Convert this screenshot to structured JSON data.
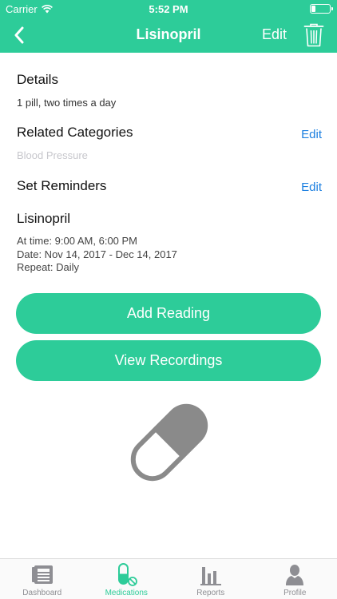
{
  "status_bar": {
    "carrier": "Carrier",
    "time": "5:52 PM"
  },
  "nav": {
    "title": "Lisinopril",
    "edit_label": "Edit"
  },
  "details": {
    "heading": "Details",
    "text": "1 pill, two times a day"
  },
  "categories": {
    "heading": "Related Categories",
    "edit_label": "Edit",
    "value": "Blood Pressure"
  },
  "reminders": {
    "heading": "Set Reminders",
    "edit_label": "Edit",
    "name": "Lisinopril",
    "time_line": "At time: 9:00 AM, 6:00 PM",
    "date_line": "Date: Nov 14, 2017 - Dec 14, 2017",
    "repeat_line": "Repeat: Daily"
  },
  "actions": {
    "add_reading": "Add Reading",
    "view_recordings": "View Recordings"
  },
  "tabs": [
    {
      "label": "Dashboard",
      "icon": "newspaper-icon",
      "active": false
    },
    {
      "label": "Medications",
      "icon": "pill-icon",
      "active": true
    },
    {
      "label": "Reports",
      "icon": "bar-chart-icon",
      "active": false
    },
    {
      "label": "Profile",
      "icon": "person-icon",
      "active": false
    }
  ],
  "colors": {
    "accent": "#2dcc99",
    "link": "#1b7fe0",
    "pill_gray": "#8a8a8a"
  }
}
